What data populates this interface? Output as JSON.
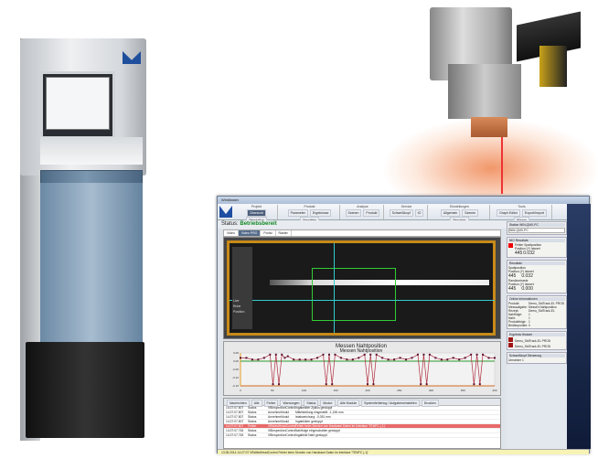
{
  "software": {
    "title": "WinMaster",
    "ribbon": {
      "groups": [
        {
          "label": "Projekt",
          "items": [
            "Übersicht",
            "Simulation"
          ]
        },
        {
          "label": "Produkt",
          "items": [
            "Parameter",
            "Ergebnisse",
            "Verwalten"
          ]
        },
        {
          "label": "Analyse",
          "items": [
            "Szenen",
            "Produkt"
          ]
        },
        {
          "label": "Service",
          "items": [
            "Schweißkopf",
            "IO"
          ]
        },
        {
          "label": "Einstellungen",
          "items": [
            "Allgemein",
            "Szenen",
            "Benutzer"
          ]
        },
        {
          "label": "Tools",
          "items": [
            "Graph Editor",
            "Export/Import",
            "Wissen"
          ]
        }
      ],
      "active": "Übersicht"
    },
    "status_label": "Status:",
    "status_value": "Betriebsbereit",
    "tabs": [
      "Video",
      "Video PRO",
      "Portal",
      "Raster"
    ],
    "active_tab": "Video PRO",
    "view_options": [
      "Live",
      "Ruhe",
      "Position"
    ],
    "log_toolbar": [
      "Nachrichten",
      "Alle",
      "Fehler",
      "Warnungen",
      "Status",
      "Modul:",
      "Alle Module",
      "Systemfehlerlog / Aufgabeneinstellen",
      "Drucken"
    ],
    "log_rows": [
      {
        "time": "14:27:07.807",
        "type": "Status",
        "module": "VBInspectionControl",
        "text": "Ingabbilder Zyklus gestoppt",
        "error": false
      },
      {
        "time": "14:27:07.807",
        "type": "Status",
        "module": "AnnehmeModul",
        "text": "Mittelstellung eingestellt: -1,156 mm",
        "error": false
      },
      {
        "time": "14:27:07.807",
        "type": "Status",
        "module": "AnnehmeModul",
        "text": "Istabweichung: -0,051 mm",
        "error": false
      },
      {
        "time": "14:27:07.807",
        "type": "Status",
        "module": "AnnehmeModul",
        "text": "Ingabbilder gestoppt",
        "error": false
      },
      {
        "time": "14:27:07.807",
        "type": "Fehler",
        "module": "VBWeldHeadControl",
        "text": "Fehler beim Senden von Hardware Daten im Interface 'TENPC (-1)'",
        "error": true
      },
      {
        "time": "14:27:07.763",
        "type": "Status",
        "module": "VBInspectionControl",
        "text": "Nahtfolge eingeschalten gestoppt",
        "error": false
      },
      {
        "time": "14:27:07.763",
        "type": "Status",
        "module": "VBInspectionControl",
        "text": "Ingabbild Naht gestoppt",
        "error": false
      }
    ],
    "footer": "13.05.2014 14:27:07 VBWeldHeadControl  Fehler beim Senden von Hardware Daten im Interface 'TENPC (-1)'",
    "right_panel": {
      "station_header": "Station WIN-QMX-PC",
      "station_value": "WIN-QMX-PC",
      "nio_header": "NIO Resultate",
      "nio_item": "Fehler Spaltposition",
      "nio_sub": "Position (Y)   Istwert",
      "nio_values": [
        "445",
        "0.032"
      ],
      "results_header": "Resultate",
      "results": [
        {
          "label": "Spaltposition",
          "sub": "Position (Y)   Istwert",
          "values": [
            "445",
            "0.032"
          ]
        },
        {
          "label": "Randkontraste",
          "sub": "Position (Y)   Istwert",
          "values": [
            "445",
            "0.000"
          ]
        }
      ],
      "online_header": "Online Informationen",
      "online": [
        [
          "Produkt:",
          "Demo_StdTrack-EL PROD"
        ],
        [
          "Messaufgabe:",
          "Messen Nahtposition"
        ],
        [
          "Rezept:",
          "Demo_StdTrack-EL"
        ],
        [
          "Nahtfolge:",
          "1"
        ],
        [
          "Naht:",
          "1"
        ],
        [
          "Produktfolge:",
          "1"
        ],
        [
          "Bedienpunkte:",
          "0"
        ]
      ],
      "history_header": "Ergebnis Historie",
      "history": [
        "Demo_StdTrack-EL PROD",
        "Demo_StdTrack-EL PROD"
      ],
      "weld_header": "Schweißkopf Steuerung",
      "weld_item": "Umsetzer 1"
    }
  },
  "chart_data": {
    "type": "line",
    "title": "Messen Nahtposition",
    "subtitle": "Messen Nahtposition",
    "xlim": [
      0,
      400
    ],
    "ylim": [
      -0.15,
      0.05
    ],
    "xticks": [
      0,
      50,
      100,
      150,
      200,
      250,
      300,
      350,
      400
    ],
    "yticks": [
      "0.05",
      "0.00",
      "-0.05",
      "-0.10",
      "-0.15"
    ],
    "reference": 0.0,
    "x": [
      0,
      10,
      20,
      30,
      40,
      50,
      55,
      60,
      65,
      70,
      75,
      80,
      90,
      100,
      110,
      120,
      130,
      140,
      145,
      150,
      155,
      160,
      170,
      180,
      190,
      200,
      210,
      215,
      220,
      225,
      230,
      240,
      250,
      260,
      270,
      280,
      290,
      300,
      305,
      310,
      315,
      320,
      330,
      340,
      350,
      360,
      370,
      380,
      390,
      395,
      400,
      405,
      410,
      420,
      430
    ],
    "y": [
      0.02,
      0.02,
      0.01,
      0.01,
      0.02,
      0.04,
      -0.14,
      0.04,
      -0.14,
      0.04,
      0.02,
      0.03,
      0.01,
      0.01,
      0.01,
      0.01,
      0.02,
      0.04,
      -0.14,
      0.04,
      -0.14,
      0.04,
      0.02,
      0.01,
      0.01,
      0.02,
      0.04,
      -0.14,
      0.04,
      -0.14,
      0.04,
      0.02,
      0.01,
      0.01,
      0.02,
      0.01,
      0.02,
      0.04,
      -0.14,
      0.04,
      -0.14,
      0.04,
      0.02,
      0.01,
      0.01,
      0.02,
      0.01,
      0.02,
      0.04,
      -0.14,
      0.04,
      -0.14,
      0.04,
      0.02,
      0.02
    ]
  }
}
